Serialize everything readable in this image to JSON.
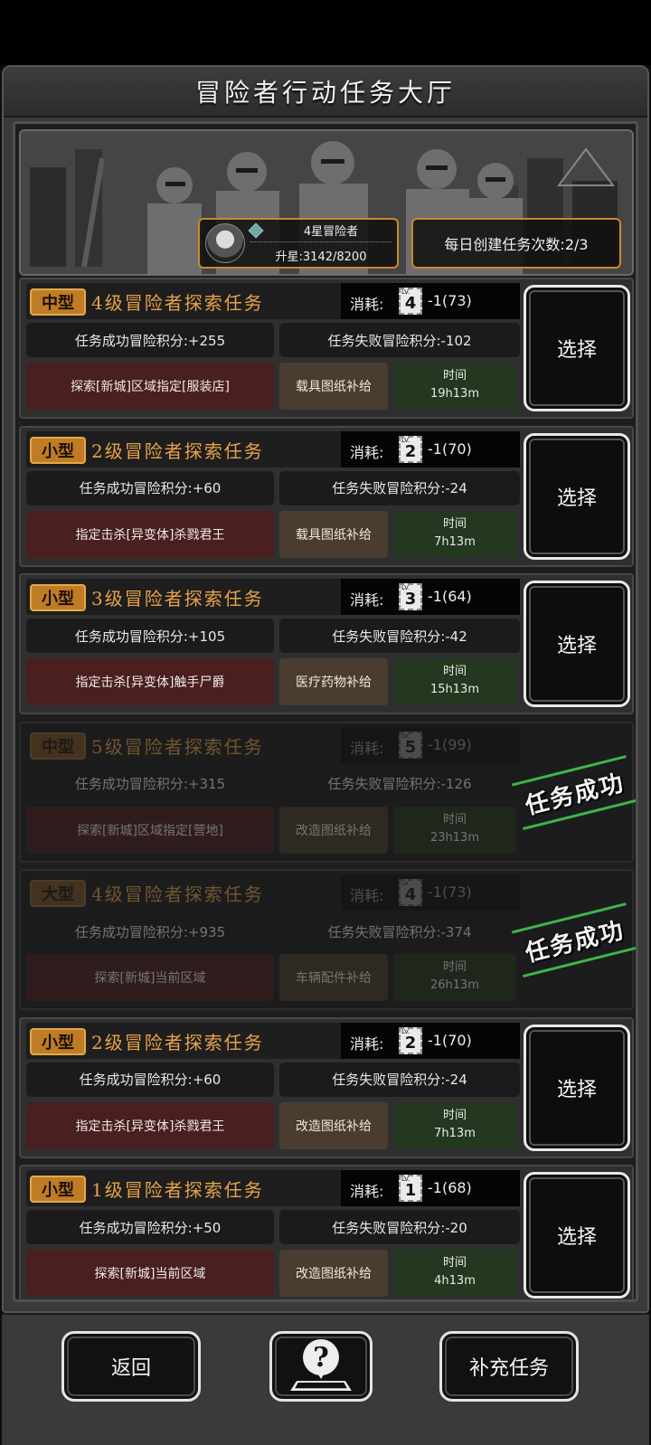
{
  "title": "冒险者行动任务大厅",
  "rank": {
    "title": "4星冒险者",
    "progress": "升星:3142/8200"
  },
  "daily": "每日创建任务次数:2/3",
  "tasks": [
    {
      "size": "中型",
      "name": "4级冒险者探索任务",
      "cost_label": "消耗:",
      "level": "4",
      "cost": "-1(73)",
      "success": "任务成功冒险积分:+255",
      "fail": "任务失败冒险积分:-102",
      "target": "探索[新城]区域指定[服装店]",
      "supply": "载具图纸补给",
      "time_label": "时间",
      "time": "19h13m",
      "action": "选择",
      "completed": false
    },
    {
      "size": "小型",
      "name": "2级冒险者探索任务",
      "cost_label": "消耗:",
      "level": "2",
      "cost": "-1(70)",
      "success": "任务成功冒险积分:+60",
      "fail": "任务失败冒险积分:-24",
      "target": "指定击杀[异变体]杀戮君王",
      "supply": "载具图纸补给",
      "time_label": "时间",
      "time": "7h13m",
      "action": "选择",
      "completed": false
    },
    {
      "size": "小型",
      "name": "3级冒险者探索任务",
      "cost_label": "消耗:",
      "level": "3",
      "cost": "-1(64)",
      "success": "任务成功冒险积分:+105",
      "fail": "任务失败冒险积分:-42",
      "target": "指定击杀[异变体]触手尸爵",
      "supply": "医疗药物补给",
      "time_label": "时间",
      "time": "15h13m",
      "action": "选择",
      "completed": false
    },
    {
      "size": "中型",
      "name": "5级冒险者探索任务",
      "cost_label": "消耗:",
      "level": "5",
      "cost": "-1(99)",
      "success": "任务成功冒险积分:+315",
      "fail": "任务失败冒险积分:-126",
      "target": "探索[新城]区域指定[营地]",
      "supply": "改造图纸补给",
      "time_label": "时间",
      "time": "23h13m",
      "action": "任务成功",
      "completed": true
    },
    {
      "size": "大型",
      "name": "4级冒险者探索任务",
      "cost_label": "消耗:",
      "level": "4",
      "cost": "-1(73)",
      "success": "任务成功冒险积分:+935",
      "fail": "任务失败冒险积分:-374",
      "target": "探索[新城]当前区域",
      "supply": "车辆配件补给",
      "time_label": "时间",
      "time": "26h13m",
      "action": "任务成功",
      "completed": true
    },
    {
      "size": "小型",
      "name": "2级冒险者探索任务",
      "cost_label": "消耗:",
      "level": "2",
      "cost": "-1(70)",
      "success": "任务成功冒险积分:+60",
      "fail": "任务失败冒险积分:-24",
      "target": "指定击杀[异变体]杀戮君王",
      "supply": "改造图纸补给",
      "time_label": "时间",
      "time": "7h13m",
      "action": "选择",
      "completed": false
    },
    {
      "size": "小型",
      "name": "1级冒险者探索任务",
      "cost_label": "消耗:",
      "level": "1",
      "cost": "-1(68)",
      "success": "任务成功冒险积分:+50",
      "fail": "任务失败冒险积分:-20",
      "target": "探索[新城]当前区域",
      "supply": "改造图纸补给",
      "time_label": "时间",
      "time": "4h13m",
      "action": "选择",
      "completed": false
    }
  ],
  "buttons": {
    "back": "返回",
    "refill": "补充任务"
  },
  "icons": {
    "help": "help-map-pin-icon",
    "rank_star": "star-gem-icon",
    "card": "level-card-icon"
  },
  "colors": {
    "accent": "#e7a24a",
    "badge": "#c07c24",
    "success_stamp": "#3fb44a",
    "fail_target": "#4a1f1f",
    "time_bg": "#24371f"
  }
}
